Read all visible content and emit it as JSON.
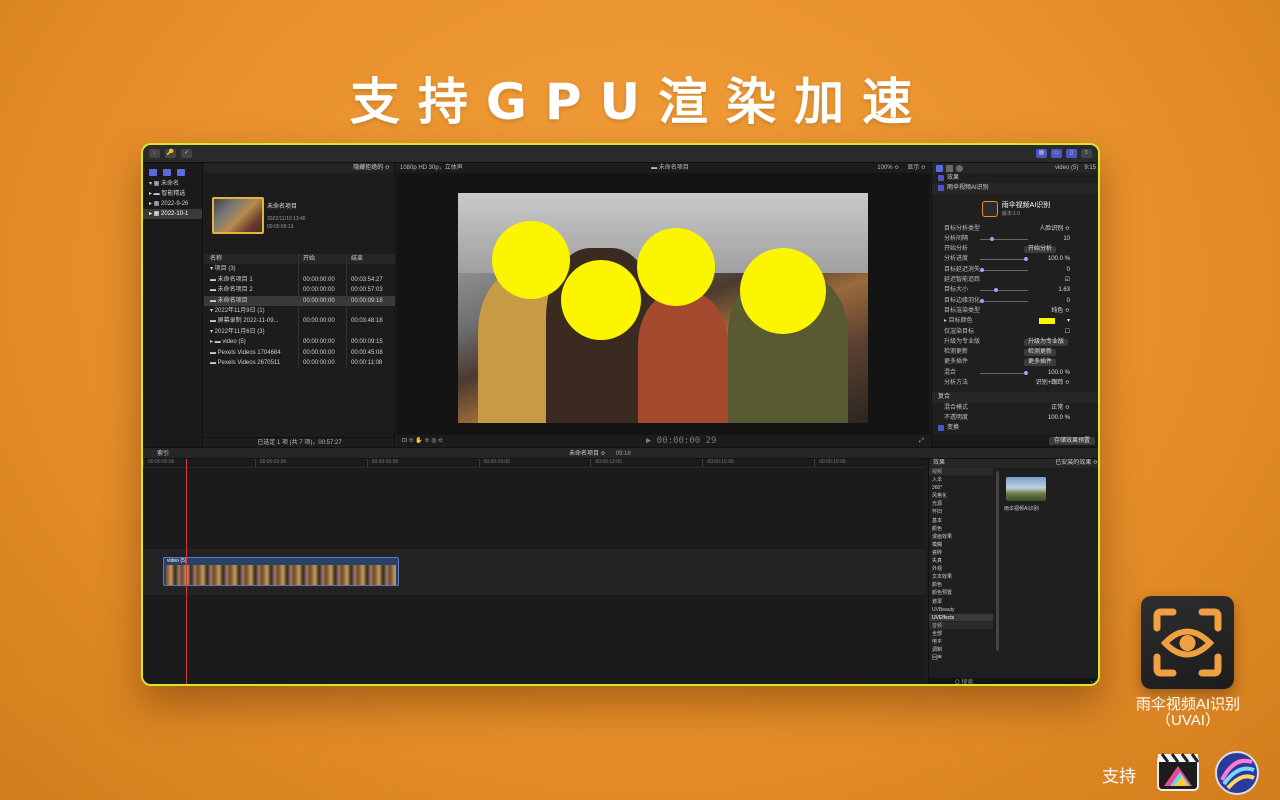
{
  "headline": "支持GPU渲染加速",
  "titlebar": {
    "buttons": [
      "↓",
      "🔑",
      "✓"
    ],
    "right_buttons": [
      "▦",
      "▭",
      "▯",
      "⇪"
    ]
  },
  "sidebar": {
    "items": [
      {
        "label": "▾ ▦ 未命名"
      },
      {
        "label": "  ▸ ▬ 智能精选"
      },
      {
        "label": "  ▸ ▦ 2022-9-26"
      },
      {
        "label": "  ▸ ▦ 2022-10-1"
      }
    ]
  },
  "browser": {
    "filter": "隐藏拒绝的 ≎",
    "clip": {
      "title": "未命名项目",
      "date": "2022/11/10 13:46",
      "duration": "00:00:09:13"
    },
    "columns": [
      "名称",
      "开始",
      "结束"
    ],
    "rows": [
      {
        "name": "▾  项目 (3)",
        "start": "",
        "end": ""
      },
      {
        "name": "      ▬ 未命名项目 1",
        "start": "00:00:00:00",
        "end": "00:03:54:27"
      },
      {
        "name": "      ▬ 未命名项目 2",
        "start": "00:00:00:00",
        "end": "00:00:57:03"
      },
      {
        "name": "      ▬ 未命名项目",
        "start": "00:00:00:00",
        "end": "00:00:09:18"
      },
      {
        "name": "▾  2022年11月9日 (1)",
        "start": "",
        "end": ""
      },
      {
        "name": "      ▬ 屏幕录制 2022-11-09...",
        "start": "00:00:00:00",
        "end": "00:03:48:18"
      },
      {
        "name": "▾  2022年11月6日 (3)",
        "start": "",
        "end": ""
      },
      {
        "name": "   ▸ ▬ video (5)",
        "start": "00:00:00:00",
        "end": "00:00:09:15"
      },
      {
        "name": "      ▬ Pexels Videos 1704684",
        "start": "00:00:00:00",
        "end": "00:00:45:08"
      },
      {
        "name": "      ▬ Pexels Videos 2670511",
        "start": "00:00:00:00",
        "end": "00:00:11:08"
      }
    ],
    "footer": "已选定 1 项 (共 7 项)，00:57:27"
  },
  "viewer": {
    "format": "1080p HD 30p，立体声",
    "project": "▬ 未命名项目",
    "zoom": "100% ≎",
    "display": "显示 ≎",
    "timecode": "▶ 00:00:00 29",
    "tools": "⊡ ≎   ✋ ≎   ◎ ≎"
  },
  "inspector": {
    "clip": "video (5)",
    "duration": "9:15",
    "effects_label": "效果",
    "plugin_label": "雨伞视频AI识别",
    "plugin_name": "雨伞视频AI识别",
    "plugin_version": "版本:1.0",
    "params": [
      {
        "label": "目标分析类型",
        "value": "人脸识别 ≎"
      },
      {
        "label": "分析间隔",
        "value": "10"
      },
      {
        "label": "开始分析",
        "button": "开始分析"
      },
      {
        "label": "分析进度",
        "value": "100.0 %"
      },
      {
        "label": "目标延迟消失",
        "value": "0"
      },
      {
        "label": "延迟智能追踪",
        "value": "☑"
      },
      {
        "label": "目标大小",
        "value": "1.63"
      },
      {
        "label": "目标边缘羽化",
        "value": "0"
      },
      {
        "label": "目标渲染类型",
        "value": "纯色 ≎"
      },
      {
        "label": "▸ 目标颜色",
        "value": "▾"
      },
      {
        "label": "仅渲染目标",
        "value": "☐"
      },
      {
        "label": "升级为专业版",
        "button": "升级为专业版"
      },
      {
        "label": "检测更新",
        "button": "检测更新"
      },
      {
        "label": "更多插件",
        "button": "更多插件"
      },
      {
        "label": "混合",
        "value": "100.0 %"
      },
      {
        "label": "分析方法",
        "value": "识别+跟踪 ≎"
      }
    ],
    "composite_label": "复合",
    "blend_label": "混合模式",
    "blend_value": "正常 ≎",
    "opacity_label": "不透明度",
    "opacity_value": "100.0 %",
    "transform_label": "变换",
    "save_button": "存储效果预置"
  },
  "timeline": {
    "index_label": "索引",
    "project": "未命名项目 ≎",
    "duration": "09:18",
    "ruler": [
      "00:00:00:00",
      "00:00:03:00",
      "00:00:06:00",
      "00:00:09:00",
      "00:00:12:00",
      "00:00:15:00",
      "00:00:18:00"
    ],
    "clip_label": "video (5)"
  },
  "effects": {
    "title": "效果",
    "installed": "已安装的效果 ≎",
    "categories": [
      {
        "label": "视频",
        "type": "hd"
      },
      {
        "label": "入伞",
        "type": ""
      },
      {
        "label": "360°",
        "type": ""
      },
      {
        "label": "风格化",
        "type": ""
      },
      {
        "label": "光源",
        "type": ""
      },
      {
        "label": "怀旧",
        "type": ""
      },
      {
        "label": "基本",
        "type": ""
      },
      {
        "label": "颜色",
        "type": ""
      },
      {
        "label": "漫画效果",
        "type": ""
      },
      {
        "label": "模糊",
        "type": ""
      },
      {
        "label": "瓷砖",
        "type": ""
      },
      {
        "label": "失真",
        "type": ""
      },
      {
        "label": "外观",
        "type": ""
      },
      {
        "label": "文本效果",
        "type": ""
      },
      {
        "label": "颜色",
        "type": ""
      },
      {
        "label": "颜色预置",
        "type": ""
      },
      {
        "label": "遮罩",
        "type": ""
      },
      {
        "label": "UVBeauty",
        "type": ""
      },
      {
        "label": "UVEffects",
        "type": "sel"
      },
      {
        "label": "音频",
        "type": "hd"
      },
      {
        "label": "全部",
        "type": ""
      },
      {
        "label": "电平",
        "type": ""
      },
      {
        "label": "调制",
        "type": ""
      },
      {
        "label": "回声",
        "type": ""
      }
    ],
    "item_label": "雨伞视频AI识别",
    "search_placeholder": "Q 搜索",
    "count": "1 项"
  },
  "app": {
    "name_line1": "雨伞视频AI识别",
    "name_line2": "（UVAI）"
  },
  "support_label": "支持"
}
